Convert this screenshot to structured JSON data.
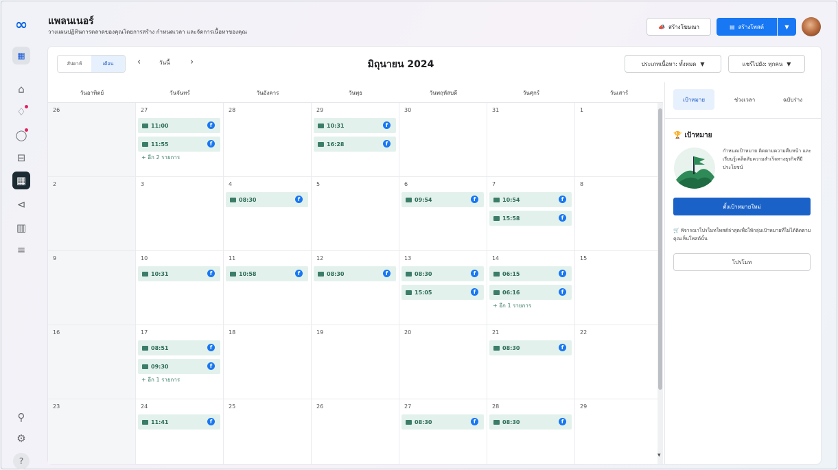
{
  "header": {
    "title": "แพลนเนอร์",
    "subtitle": "วางแผนปฏิทินการตลาดของคุณโดยการสร้าง กำหนดเวลา และจัดการเนื้อหาของคุณ",
    "create_ad_label": "สร้างโฆษณา",
    "create_post_label": "สร้างโพสต์"
  },
  "toolbar": {
    "view_week": "สัปดาห์",
    "view_month": "เดือน",
    "today": "วันนี้",
    "month_title": "มิถุนายน 2024",
    "content_type_filter": "ประเภทเนื้อหา: ทั้งหมด",
    "account_filter": "แชร์ไปยัง: ทุกคน"
  },
  "calendar": {
    "weekdays": [
      "วันอาทิตย์",
      "วันจันทร์",
      "วันอังคาร",
      "วันพุธ",
      "วันพฤหัสบดี",
      "วันศุกร์",
      "วันเสาร์"
    ],
    "weeks": [
      [
        {
          "day": "26",
          "off": true,
          "events": []
        },
        {
          "day": "27",
          "events": [
            "11:00",
            "11:55"
          ],
          "more": "+ อีก 2 รายการ"
        },
        {
          "day": "28",
          "events": []
        },
        {
          "day": "29",
          "events": [
            "10:31",
            "16:28"
          ]
        },
        {
          "day": "30",
          "events": []
        },
        {
          "day": "31",
          "events": []
        },
        {
          "day": "1",
          "events": []
        }
      ],
      [
        {
          "day": "2",
          "off": true,
          "events": []
        },
        {
          "day": "3",
          "events": []
        },
        {
          "day": "4",
          "events": [
            "08:30"
          ]
        },
        {
          "day": "5",
          "events": []
        },
        {
          "day": "6",
          "events": [
            "09:54"
          ]
        },
        {
          "day": "7",
          "events": [
            "10:54",
            "15:58"
          ]
        },
        {
          "day": "8",
          "events": []
        }
      ],
      [
        {
          "day": "9",
          "off": true,
          "events": []
        },
        {
          "day": "10",
          "events": [
            "10:31"
          ]
        },
        {
          "day": "11",
          "events": [
            "10:58"
          ]
        },
        {
          "day": "12",
          "events": [
            "08:30"
          ]
        },
        {
          "day": "13",
          "events": [
            "08:30",
            "15:05"
          ]
        },
        {
          "day": "14",
          "events": [
            "06:15",
            "06:16"
          ],
          "more": "+ อีก 1 รายการ"
        },
        {
          "day": "15",
          "events": []
        }
      ],
      [
        {
          "day": "16",
          "off": true,
          "events": []
        },
        {
          "day": "17",
          "events": [
            "08:51",
            "09:30"
          ],
          "more": "+ อีก 1 รายการ"
        },
        {
          "day": "18",
          "events": []
        },
        {
          "day": "19",
          "events": []
        },
        {
          "day": "20",
          "events": []
        },
        {
          "day": "21",
          "events": [
            "08:30"
          ]
        },
        {
          "day": "22",
          "events": []
        }
      ],
      [
        {
          "day": "23",
          "off": true,
          "events": []
        },
        {
          "day": "24",
          "events": [
            "11:41"
          ]
        },
        {
          "day": "25",
          "events": []
        },
        {
          "day": "26",
          "events": []
        },
        {
          "day": "27",
          "events": [
            "08:30"
          ]
        },
        {
          "day": "28",
          "events": [
            "08:30"
          ]
        },
        {
          "day": "29",
          "events": []
        }
      ]
    ]
  },
  "panel": {
    "tabs": [
      "เป้าหมาย",
      "ช่วงเวลา",
      "ฉบับร่าง"
    ],
    "goal_heading": "เป้าหมาย",
    "goal_text": "กำหนดเป้าหมาย ติดตามความคืบหน้า และเรียนรู้เคล็ดลับความสำเร็จทางธุรกิจที่มีประโยชน์",
    "new_goal_button": "ตั้งเป้าหมายใหม่",
    "promo_text": "พิจารณาโปรโมทโพสต์ล่าสุดเพื่อให้กลุ่มเป้าหมายที่ไม่ได้ติดตามคุณเห็นโพสต์นั้น",
    "promote_button": "โปรโมท"
  },
  "colors": {
    "accent": "#1877f2",
    "event_bg": "#e3f1ec",
    "event_text": "#2c6a56",
    "sidebar_active": "#1c2b33"
  }
}
